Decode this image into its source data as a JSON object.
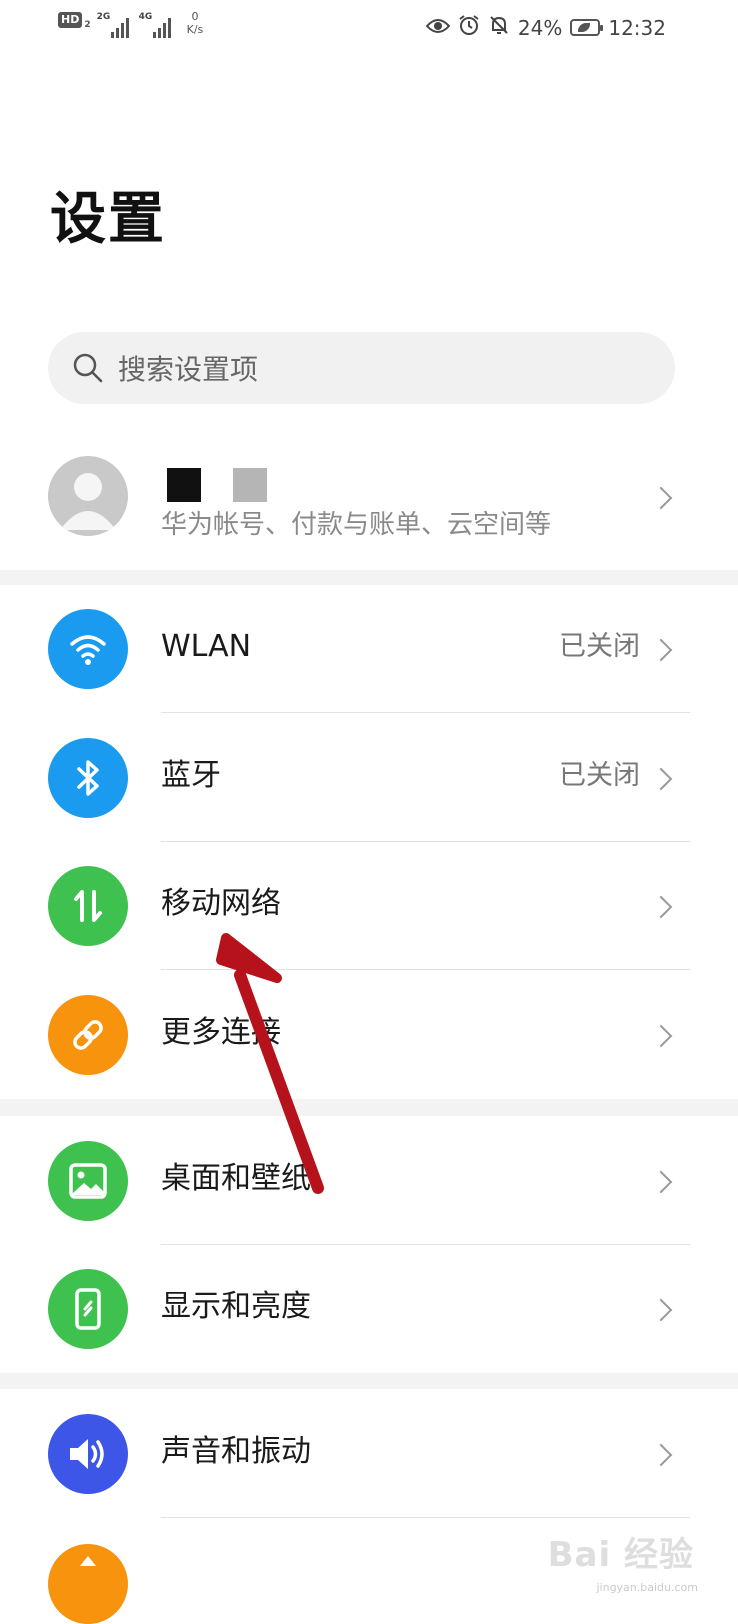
{
  "status_bar": {
    "hd_label": "HD",
    "hd_sub": "2",
    "sim1_label": "2G",
    "sim2_label": "4G",
    "speed_value": "0",
    "speed_unit": "K/s",
    "battery_percent": "24%",
    "time": "12:32",
    "icons": [
      "eye-icon",
      "alarm-icon",
      "bell-off-icon",
      "battery-saver-icon"
    ]
  },
  "header": {
    "title": "设置"
  },
  "search": {
    "placeholder": "搜索设置项"
  },
  "account": {
    "subtitle": "华为帐号、付款与账单、云空间等"
  },
  "settings": [
    {
      "label": "WLAN",
      "status": "已关闭",
      "icon": "wifi-icon",
      "color": "#1a9bf0"
    },
    {
      "label": "蓝牙",
      "status": "已关闭",
      "icon": "bluetooth-icon",
      "color": "#1a9bf0"
    },
    {
      "label": "移动网络",
      "status": "",
      "icon": "mobile-data-icon",
      "color": "#3fc14f"
    },
    {
      "label": "更多连接",
      "status": "",
      "icon": "link-icon",
      "color": "#f7930c"
    },
    {
      "label": "桌面和壁纸",
      "status": "",
      "icon": "wallpaper-icon",
      "color": "#3fc14f"
    },
    {
      "label": "显示和亮度",
      "status": "",
      "icon": "display-icon",
      "color": "#3fc14f"
    },
    {
      "label": "声音和振动",
      "status": "",
      "icon": "sound-icon",
      "color": "#3d56e8"
    }
  ],
  "annotation": {
    "arrow_color": "#b5121b"
  },
  "watermark": {
    "text": "Bai 经验",
    "sub": "jingyan.baidu.com"
  }
}
